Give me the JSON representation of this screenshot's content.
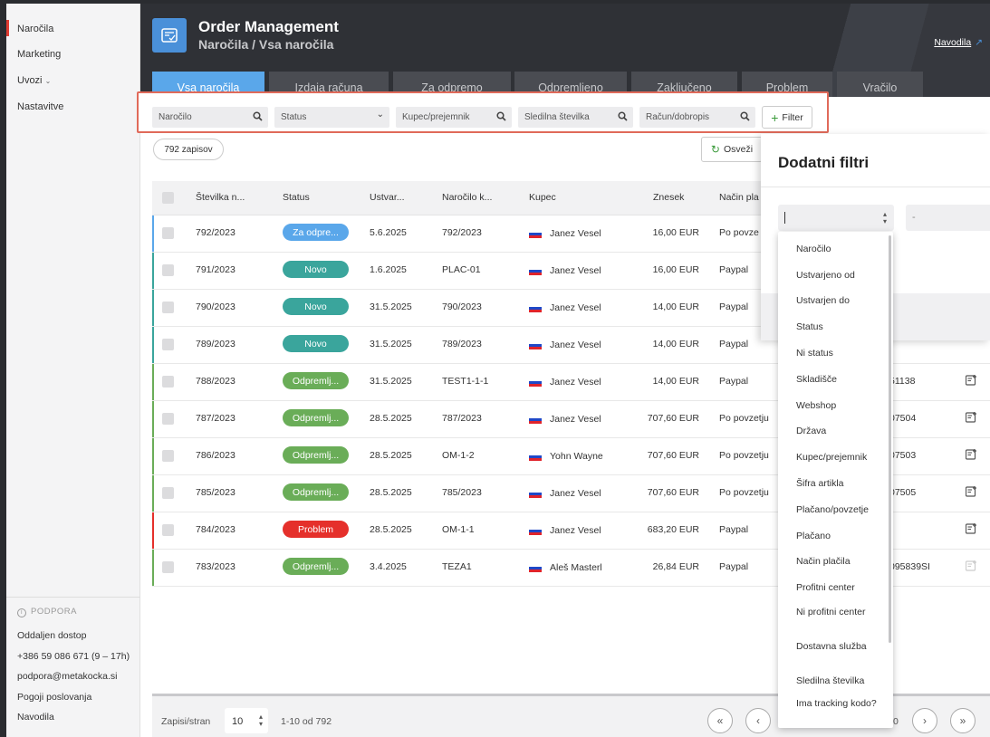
{
  "sidebar": {
    "items": [
      {
        "label": "Naročila",
        "active": true
      },
      {
        "label": "Marketing"
      },
      {
        "label": "Uvozi"
      },
      {
        "label": "Nastavitve"
      }
    ],
    "support": {
      "title": "PODPORA",
      "links": [
        "Oddaljen dostop",
        "+386 59 086 671 (9 – 17h)",
        "podpora@metakocka.si",
        "Pogoji poslovanja",
        "Navodila"
      ]
    }
  },
  "header": {
    "title": "Order Management",
    "breadcrumb": "Naročila / Vsa naročila",
    "help_link": "Navodila",
    "accent": "#5aa7ea"
  },
  "tabs": [
    {
      "label": "Vsa naročila",
      "active": true
    },
    {
      "label": "Izdaja računa"
    },
    {
      "label": "Za odpremo"
    },
    {
      "label": "Odpremljeno"
    },
    {
      "label": "Zaključeno"
    },
    {
      "label": "Problem"
    },
    {
      "label": "Vračilo"
    }
  ],
  "filters": {
    "order_placeholder": "Naročilo",
    "status_placeholder": "Status",
    "buyer_placeholder": "Kupec/prejemnik",
    "tracking_placeholder": "Sledilna številka",
    "invoice_placeholder": "Račun/dobropis",
    "filter_button": "Filter"
  },
  "toolbar": {
    "record_count": "792 zapisov",
    "refresh_button": "Osveži"
  },
  "table": {
    "columns": [
      "Številka n...",
      "Status",
      "Ustvar...",
      "Naročilo k...",
      "Kupec",
      "Znesek",
      "Način pla"
    ],
    "rows": [
      {
        "number": "792/2023",
        "status": "Za odpre...",
        "status_color": "#5aa7ea",
        "bar_color": "#5aa7ea",
        "created": "5.6.2025",
        "order_ref": "792/2023",
        "buyer": "Janez Vesel",
        "amount": "16,00 EUR",
        "payment": "Po povze",
        "extra": ""
      },
      {
        "number": "791/2023",
        "status": "Novo",
        "status_color": "#3aa59c",
        "bar_color": "#3aa59c",
        "created": "1.6.2025",
        "order_ref": "PLAC-01",
        "buyer": "Janez Vesel",
        "amount": "16,00 EUR",
        "payment": "Paypal",
        "extra": ""
      },
      {
        "number": "790/2023",
        "status": "Novo",
        "status_color": "#3aa59c",
        "bar_color": "#3aa59c",
        "created": "31.5.2025",
        "order_ref": "790/2023",
        "buyer": "Janez Vesel",
        "amount": "14,00 EUR",
        "payment": "Paypal",
        "extra": ""
      },
      {
        "number": "789/2023",
        "status": "Novo",
        "status_color": "#3aa59c",
        "bar_color": "#3aa59c",
        "created": "31.5.2025",
        "order_ref": "789/2023",
        "buyer": "Janez Vesel",
        "amount": "14,00 EUR",
        "payment": "Paypal",
        "extra": ""
      },
      {
        "number": "788/2023",
        "status": "Odpremlj...",
        "status_color": "#6aad58",
        "bar_color": "#6aad58",
        "created": "31.5.2025",
        "order_ref": "TEST1-1-1",
        "buyer": "Janez Vesel",
        "amount": "14,00 EUR",
        "payment": "Paypal",
        "extra": "51138"
      },
      {
        "number": "787/2023",
        "status": "Odpremlj...",
        "status_color": "#6aad58",
        "bar_color": "#6aad58",
        "created": "28.5.2025",
        "order_ref": "787/2023",
        "buyer": "Janez Vesel",
        "amount": "707,60 EUR",
        "payment": "Po povzetju",
        "extra": "07504"
      },
      {
        "number": "786/2023",
        "status": "Odpremlj...",
        "status_color": "#6aad58",
        "bar_color": "#6aad58",
        "created": "28.5.2025",
        "order_ref": "OM-1-2",
        "buyer": "Yohn Wayne",
        "amount": "707,60 EUR",
        "payment": "Po povzetju",
        "extra": "07503"
      },
      {
        "number": "785/2023",
        "status": "Odpremlj...",
        "status_color": "#6aad58",
        "bar_color": "#6aad58",
        "created": "28.5.2025",
        "order_ref": "785/2023",
        "buyer": "Janez Vesel",
        "amount": "707,60 EUR",
        "payment": "Po povzetju",
        "extra": "07505"
      },
      {
        "number": "784/2023",
        "status": "Problem",
        "status_color": "#e5302b",
        "bar_color": "#e5302b",
        "created": "28.5.2025",
        "order_ref": "OM-1-1",
        "buyer": "Janez Vesel",
        "amount": "683,20 EUR",
        "payment": "Paypal",
        "extra": ""
      },
      {
        "number": "783/2023",
        "status": "Odpremlj...",
        "status_color": "#6aad58",
        "bar_color": "#6aad58",
        "created": "3.4.2025",
        "order_ref": "TEZA1",
        "buyer": "Aleš Masterl",
        "amount": "26,84 EUR",
        "payment": "Paypal",
        "extra": "095839SI"
      }
    ]
  },
  "pagination": {
    "per_page_label": "Zapisi/stran",
    "per_page_value": "10",
    "range": "1-10 od 792",
    "page_fragment": "0"
  },
  "panel": {
    "title": "Dodatni filtri",
    "value_placeholder": "-"
  },
  "dropdown": {
    "options": [
      "Naročilo",
      "Ustvarjeno od",
      "Ustvarjen do",
      "Status",
      "Ni status",
      "Skladišče",
      "Webshop",
      "Država",
      "Kupec/prejemnik",
      "Šifra artikla",
      "Plačano/povzetje",
      "Plačano",
      "Način plačila",
      "Profitni center",
      "Ni profitni center",
      "Dostavna služba",
      "Sledilna številka",
      "Ima tracking kodo?"
    ]
  }
}
